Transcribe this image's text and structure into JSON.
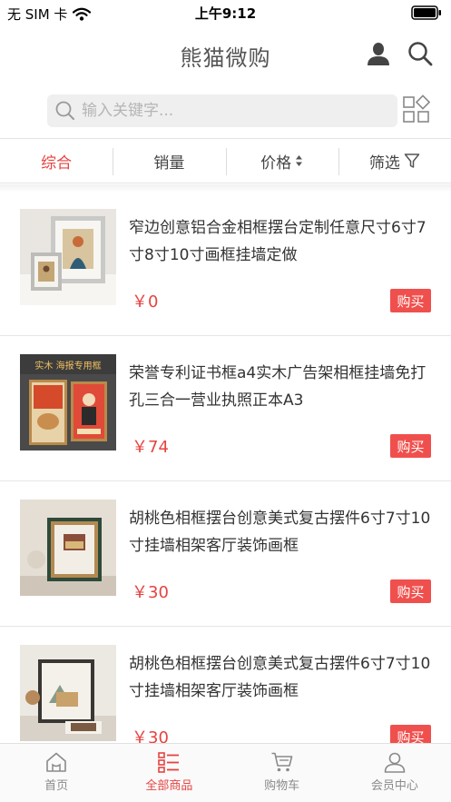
{
  "status_bar": {
    "carrier": "无 SIM 卡",
    "time": "上午9:12"
  },
  "header": {
    "title": "熊猫微购",
    "icons": {
      "user": "user-icon",
      "search": "search-icon"
    }
  },
  "search": {
    "placeholder": "输入关键字..."
  },
  "sort_tabs": [
    {
      "label": "综合",
      "active": true
    },
    {
      "label": "销量",
      "active": false
    },
    {
      "label": "价格",
      "active": false,
      "icon": "sort-updown-icon"
    },
    {
      "label": "筛选",
      "active": false,
      "icon": "filter-icon"
    }
  ],
  "products": [
    {
      "name": "窄边创意铝合金相框摆台定制任意尺寸6寸7寸8寸10寸画框挂墙定做",
      "price": "￥0",
      "buy_label": "购买"
    },
    {
      "name": "荣誉专利证书框a4实木广告架相框挂墙免打孔三合一营业执照正本A3",
      "price": "￥74",
      "buy_label": "购买",
      "image_text": "实木 海报专用框"
    },
    {
      "name": "胡桃色相框摆台创意美式复古摆件6寸7寸10寸挂墙相架客厅装饰画框",
      "price": "￥30",
      "buy_label": "购买"
    },
    {
      "name": "胡桃色相框摆台创意美式复古摆件6寸7寸10寸挂墙相架客厅装饰画框",
      "price": "￥30",
      "buy_label": "购买"
    }
  ],
  "tab_bar": [
    {
      "label": "首页",
      "icon": "home-icon",
      "active": false
    },
    {
      "label": "全部商品",
      "icon": "list-icon",
      "active": true
    },
    {
      "label": "购物车",
      "icon": "cart-icon",
      "active": false
    },
    {
      "label": "会员中心",
      "icon": "member-icon",
      "active": false
    }
  ],
  "colors": {
    "accent": "#e64340",
    "buy_button": "#f0504d"
  }
}
